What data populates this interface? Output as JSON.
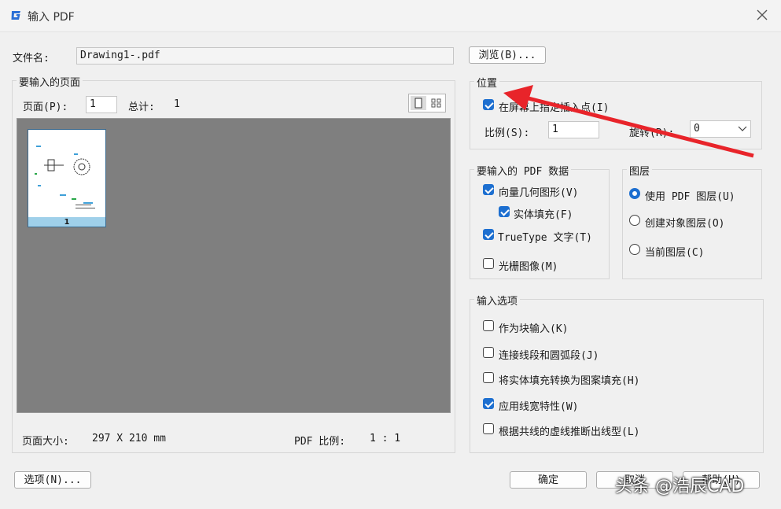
{
  "window": {
    "title": "输入 PDF"
  },
  "file": {
    "label": "文件名:",
    "value": "Drawing1-.pdf",
    "browse_label": "浏览(B)..."
  },
  "pages": {
    "group_title": "要输入的页面",
    "page_label": "页面(P):",
    "page_value": "1",
    "total_label": "总计:",
    "total_value": "1",
    "thumb_number": "1",
    "page_size_label": "页面大小:",
    "page_size_value": "297 X 210 mm",
    "pdf_scale_label": "PDF 比例:",
    "pdf_scale_value": "1 : 1"
  },
  "position": {
    "group_title": "位置",
    "insert_point_label": "在屏幕上指定插入点(I)",
    "insert_point_checked": true,
    "scale_label": "比例(S):",
    "scale_value": "1",
    "rotation_label": "旋转(R):",
    "rotation_value": "0"
  },
  "pdf_data": {
    "group_title": "要输入的 PDF 数据",
    "vector_label": "向量几何图形(V)",
    "solid_fill_label": "实体填充(F)",
    "truetype_label": "TrueType 文字(T)",
    "raster_label": "光栅图像(M)"
  },
  "layers": {
    "group_title": "图层",
    "use_pdf_layers": "使用 PDF 图层(U)",
    "create_object_layers": "创建对象图层(O)",
    "current_layer": "当前图层(C)"
  },
  "import_options": {
    "group_title": "输入选项",
    "as_block": "作为块输入(K)",
    "join_segments": "连接线段和圆弧段(J)",
    "convert_fills": "将实体填充转换为图案填充(H)",
    "apply_lineweight": "应用线宽特性(W)",
    "infer_linetypes": "根据共线的虚线推断出线型(L)"
  },
  "footer": {
    "options_label": "选项(N)...",
    "ok_label": "确定",
    "cancel_label": "取消",
    "help_label": "帮助(H)"
  },
  "watermark": "头条 @浩辰CAD",
  "colors": {
    "accent": "#1d6fd0",
    "annotation_arrow": "#e8242a",
    "preview_bg": "#7f7f7f"
  }
}
